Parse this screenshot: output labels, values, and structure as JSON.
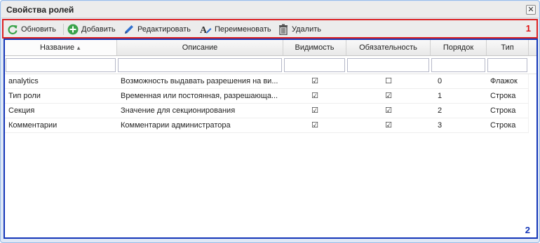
{
  "window": {
    "title": "Свойства ролей",
    "close_glyph": "✕"
  },
  "toolbar": {
    "refresh_label": "Обновить",
    "add_label": "Добавить",
    "edit_label": "Редактировать",
    "rename_label": "Переименовать",
    "delete_label": "Удалить",
    "marker": "1",
    "icons": [
      "refresh-icon",
      "add-icon",
      "edit-icon",
      "rename-icon",
      "delete-icon"
    ],
    "colors": {
      "refresh": "#3aa34a",
      "add": "#3aa34a",
      "edit": "#2f6fcf",
      "delete": "#555555",
      "marker": "#e01010"
    }
  },
  "grid": {
    "marker": "2",
    "marker_color": "#1436b8",
    "sorted_column": "name",
    "sort_direction": "asc",
    "columns": {
      "name": "Название",
      "description": "Описание",
      "visibility": "Видимость",
      "required": "Обязательность",
      "order": "Порядок",
      "type": "Тип"
    },
    "rows": [
      {
        "name": "analytics",
        "description": "Возможность выдавать разрешения на ви...",
        "visible": "☑",
        "required": "☐",
        "order": "0",
        "type": "Флажок"
      },
      {
        "name": "Тип роли",
        "description": "Временная или постоянная, разрешающа...",
        "visible": "☑",
        "required": "☑",
        "order": "1",
        "type": "Строка"
      },
      {
        "name": "Секция",
        "description": "Значение для секционирования",
        "visible": "☑",
        "required": "☑",
        "order": "2",
        "type": "Строка"
      },
      {
        "name": "Комментарии",
        "description": "Комментарии администратора",
        "visible": "☑",
        "required": "☑",
        "order": "3",
        "type": "Строка"
      }
    ]
  }
}
